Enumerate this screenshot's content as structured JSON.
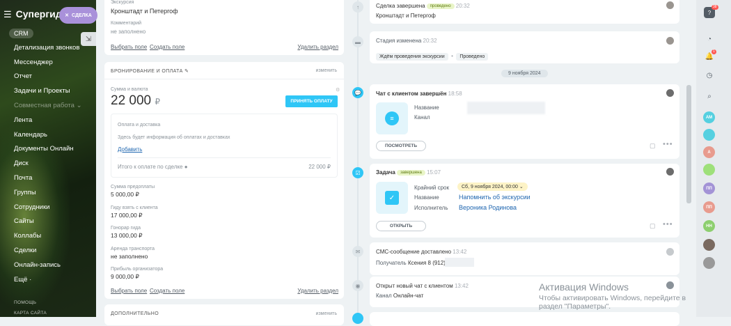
{
  "sidebar": {
    "brand": "Супергидь",
    "crm_chip": "CRM",
    "items": [
      {
        "label": "Детализация звонков",
        "group": false
      },
      {
        "label": "Мессенджер",
        "group": false
      },
      {
        "label": "Отчет",
        "group": false
      },
      {
        "label": "Задачи и Проекты",
        "group": false
      },
      {
        "label": "Совместная работа ⌄",
        "group": true
      },
      {
        "label": "Лента",
        "group": false
      },
      {
        "label": "Календарь",
        "group": false
      },
      {
        "label": "Документы Онлайн",
        "group": false
      },
      {
        "label": "Диск",
        "group": false
      },
      {
        "label": "Почта",
        "group": false
      },
      {
        "label": "Группы",
        "group": false
      },
      {
        "label": "Сотрудники",
        "group": false
      },
      {
        "label": "Сайты",
        "group": false
      },
      {
        "label": "Коллабы",
        "group": false
      },
      {
        "label": "Сделки",
        "group": false
      },
      {
        "label": "Онлайн-запись",
        "group": false
      },
      {
        "label": "Ещё ·",
        "group": false
      }
    ],
    "footer_help": "ПОМОЩЬ",
    "footer_map": "КАРТА САЙТА"
  },
  "deal_pill": {
    "icon": "✕",
    "label": "СДЕЛКА"
  },
  "top_card": {
    "excursion_label": "Экскурсия",
    "excursion_value": "Кронштадт и Петергоф",
    "comment_label": "Комментарий",
    "comment_value": "не заполнено",
    "select_field": "Выбрать поле",
    "create_field": "Создать поле",
    "delete_section": "Удалить раздел"
  },
  "booking": {
    "title": "БРОНИРОВАНИЕ И ОПЛАТА",
    "edit": "изменить",
    "amount_label": "Сумма и валюта",
    "amount": "22 000",
    "currency": "₽",
    "accept_button": "ПРИНЯТЬ ОПЛАТУ",
    "payments_title": "Оплата и доставка",
    "payments_hint": "Здесь будет информация об оплатах и доставках",
    "add": "Добавить",
    "total_label": "Итого к оплате по сделке",
    "total_value": "22 000 ₽",
    "fields": [
      {
        "label": "Сумма предоплаты",
        "value": "5 000,00 ₽"
      },
      {
        "label": "Гиду взять с клиента",
        "value": "17 000,00 ₽"
      },
      {
        "label": "Гонорар гида",
        "value": "13 000,00 ₽"
      },
      {
        "label": "Аренда транспорта",
        "value": "не заполнено"
      },
      {
        "label": "Прибыль организатора",
        "value": "9 000,00 ₽"
      }
    ],
    "select_field": "Выбрать поле",
    "create_field": "Создать поле",
    "delete_section": "Удалить раздел"
  },
  "additional": {
    "title": "ДОПОЛНИТЕЛЬНО",
    "edit": "изменить"
  },
  "timeline": {
    "deal_done": {
      "title": "Сделка завершена",
      "tag": "проведено",
      "time": "20:32",
      "text": "Кронштадт и Петергоф"
    },
    "stage": {
      "title": "Стадия изменена",
      "time": "20:32",
      "from": "Ждём проведения экскурсии",
      "arrow": "•",
      "to": "Проведено"
    },
    "date_sep": "9 ноября 2024",
    "chat": {
      "title": "Чат с клиентом завершён",
      "time": "18:58",
      "name_label": "Название",
      "channel_label": "Канал",
      "button": "ПОСМОТРЕТЬ"
    },
    "task": {
      "title": "Задача",
      "tag": "завершена",
      "time": "15:07",
      "deadline_label": "Крайний срок",
      "deadline": "Сб, 9 ноября 2024, 00:00",
      "name_label": "Название",
      "name": "Напомнить об экскурсии",
      "exec_label": "Исполнитель",
      "exec": "Вероника Родинова",
      "button": "ОТКРЫТЬ"
    },
    "sms": {
      "title": "СМС-сообщение доставлено",
      "time": "13:42",
      "recipient_label": "Получатель",
      "recipient": "Ксения 8 (912) 7"
    },
    "open_chat": {
      "title": "Открыт новый чат с клиентом",
      "time": "13:42",
      "channel_label": "Канал",
      "channel": "Онлайн-чат"
    }
  },
  "right_panel": {
    "help": "?",
    "notif_badge": "1",
    "help_badge": "38",
    "avatars": [
      {
        "initials": "АМ",
        "color": "#55d0e0"
      },
      {
        "initials": "",
        "color": "#55d0e0"
      },
      {
        "initials": "А",
        "color": "#e89b8e"
      },
      {
        "initials": "",
        "color": "#9ee07a"
      },
      {
        "initials": "ПП",
        "color": "#a393d6"
      },
      {
        "initials": "ПП",
        "color": "#e89b8e"
      },
      {
        "initials": "НН",
        "color": "#8dcf6f"
      },
      {
        "initials": "",
        "color": "#7a6a60"
      },
      {
        "initials": "",
        "color": "#999999"
      }
    ]
  },
  "watermark": {
    "title": "Активация Windows",
    "line1": "Чтобы активировать Windows, перейдите в",
    "line2": "раздел \"Параметры\"."
  }
}
